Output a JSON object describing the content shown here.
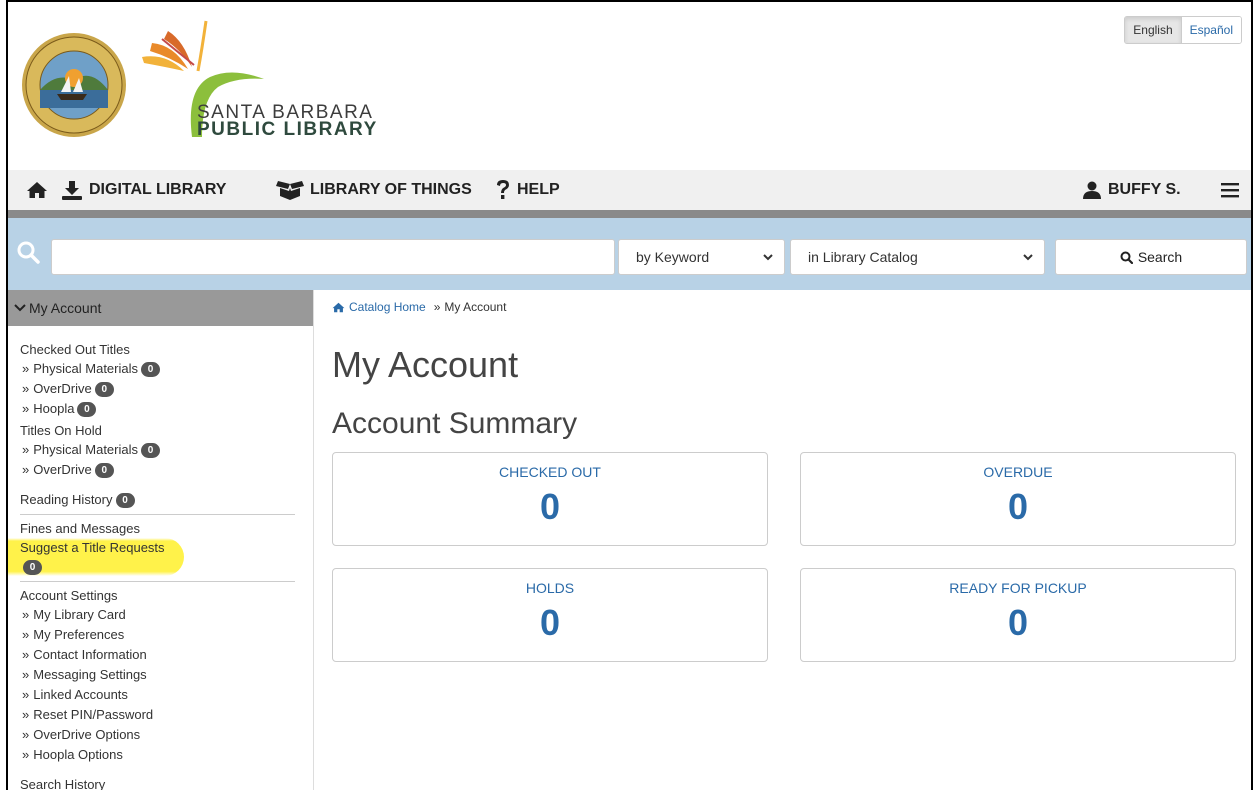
{
  "header": {
    "library_line1": "SANTA BARBARA",
    "library_line2": "PUBLIC LIBRARY",
    "seal_text": "SEAL OF THE CITY OF SANTA BARBARA CALIFORNIA",
    "languages": [
      "English",
      "Español"
    ],
    "active_language": "English"
  },
  "nav": {
    "items": [
      {
        "label": "DIGITAL LIBRARY",
        "icon": "download-icon"
      },
      {
        "label": "LIBRARY OF THINGS",
        "icon": "box-icon"
      },
      {
        "label": "HELP",
        "icon": "question-icon"
      }
    ],
    "user_label": "BUFFY S."
  },
  "search": {
    "query": "",
    "type_selected": "by Keyword",
    "scope_selected": "in Library Catalog",
    "button_label": "Search"
  },
  "sidebar": {
    "heading": "My Account",
    "checked_out": "Checked Out Titles",
    "checked_out_items": [
      {
        "label": "Physical Materials",
        "count": "0"
      },
      {
        "label": "OverDrive",
        "count": "0"
      },
      {
        "label": "Hoopla",
        "count": "0"
      }
    ],
    "on_hold": "Titles On Hold",
    "on_hold_items": [
      {
        "label": "Physical Materials",
        "count": "0"
      },
      {
        "label": "OverDrive",
        "count": "0"
      }
    ],
    "reading_history": {
      "label": "Reading History",
      "count": "0"
    },
    "fines": "Fines and Messages",
    "suggest": {
      "label": "Suggest a Title Requests",
      "count": "0"
    },
    "settings": "Account Settings",
    "settings_items": [
      "My Library Card",
      "My Preferences",
      "Contact Information",
      "Messaging Settings",
      "Linked Accounts",
      "Reset PIN/Password",
      "OverDrive Options",
      "Hoopla Options"
    ],
    "search_history": "Search History"
  },
  "breadcrumb": {
    "home": "Catalog Home",
    "current": "My Account"
  },
  "main": {
    "title": "My Account",
    "subtitle": "Account Summary",
    "cards": [
      {
        "label": "CHECKED OUT",
        "value": "0"
      },
      {
        "label": "OVERDUE",
        "value": "0"
      },
      {
        "label": "HOLDS",
        "value": "0"
      },
      {
        "label": "READY FOR PICKUP",
        "value": "0"
      }
    ]
  },
  "colors": {
    "link": "#2a6aa8",
    "nav_bg": "#f0f0f0",
    "search_band": "#b8d2e6",
    "sidebar_head": "#999999",
    "highlight": "#fff24a"
  }
}
